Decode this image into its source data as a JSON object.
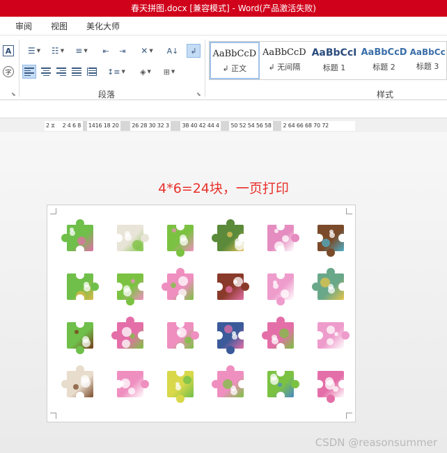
{
  "window": {
    "title": "春天拼图.docx [兼容模式] - Word(产品激活失败)"
  },
  "menu": {
    "tabs": [
      "审阅",
      "视图",
      "美化大师"
    ]
  },
  "ribbon": {
    "paragraph_label": "段落",
    "styles_label": "样式",
    "styles": [
      {
        "preview": "AaBbCcD",
        "name": "↲ 正文"
      },
      {
        "preview": "AaBbCcD",
        "name": "↲ 无间隔"
      },
      {
        "preview": "AaBbCcI",
        "name": "标题 1"
      },
      {
        "preview": "AaBbCcD",
        "name": "标题 2"
      },
      {
        "preview": "AaBbCc",
        "name": "标题 3"
      }
    ]
  },
  "ruler": {
    "segments": [
      "2",
      "2 4 6 8",
      "1416 18 20",
      "26 28 30 32 3",
      "38 40 42 44 4",
      "50 52 54 56 58",
      "2 64 66 68 70 72"
    ]
  },
  "document": {
    "heading": "4*6=24块，一页打印",
    "grid": {
      "rows": 4,
      "cols": 6
    },
    "pieces": [
      {
        "base": "#6fbf4a",
        "accent": "#e46fa8"
      },
      {
        "base": "#e9e4d8",
        "accent": "#7cc242"
      },
      {
        "base": "#7cc242",
        "accent": "#ef8fc0"
      },
      {
        "base": "#5a8a3a",
        "accent": "#e6c25a"
      },
      {
        "base": "#e58cc0",
        "accent": "#ffffff"
      },
      {
        "base": "#7a4a2a",
        "accent": "#4fb0c8"
      },
      {
        "base": "#6fbf4a",
        "accent": "#d9b84a"
      },
      {
        "base": "#7cc242",
        "accent": "#ef8fc0"
      },
      {
        "base": "#ef8fc0",
        "accent": "#7cc242"
      },
      {
        "base": "#8a3a2a",
        "accent": "#e46fa8"
      },
      {
        "base": "#ee9ccc",
        "accent": "#ffffff"
      },
      {
        "base": "#6aa88a",
        "accent": "#e4c44a"
      },
      {
        "base": "#6fbf4a",
        "accent": "#7a3a1a"
      },
      {
        "base": "#e46fa8",
        "accent": "#7cc242"
      },
      {
        "base": "#ef8fc0",
        "accent": "#7cc242"
      },
      {
        "base": "#3a5a9a",
        "accent": "#e46fa8"
      },
      {
        "base": "#e46fa8",
        "accent": "#7cc242"
      },
      {
        "base": "#ee9ccc",
        "accent": "#ffffff"
      },
      {
        "base": "#e8dccc",
        "accent": "#7a4a2a"
      },
      {
        "base": "#ef8fc0",
        "accent": "#ffffff"
      },
      {
        "base": "#d8d84a",
        "accent": "#6fbf4a"
      },
      {
        "base": "#ef8fc0",
        "accent": "#7cc242"
      },
      {
        "base": "#7cc242",
        "accent": "#4a8ac8"
      },
      {
        "base": "#e46fa8",
        "accent": "#ffffff"
      }
    ]
  },
  "watermark": "CSDN @reasonsummer"
}
